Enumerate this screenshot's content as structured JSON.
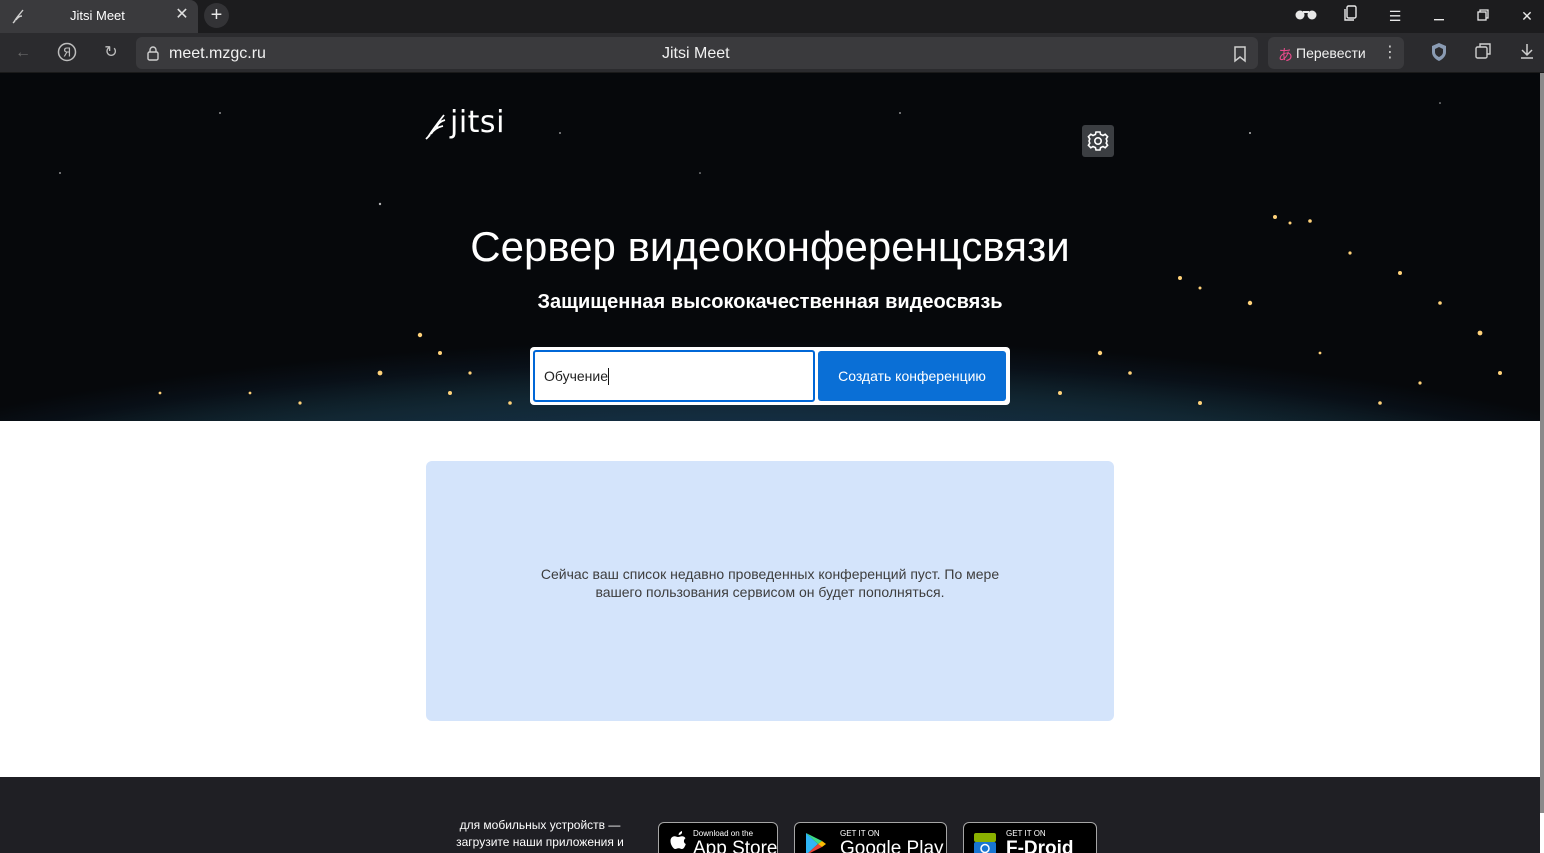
{
  "browser": {
    "tab_title": "Jitsi Meet",
    "url": "meet.mzgc.ru",
    "page_title": "Jitsi Meet",
    "translate_label": "Перевести"
  },
  "hero": {
    "logo_text": "jitsi",
    "title": "Сервер видеоконференцсвязи",
    "subtitle": "Защищенная высококачественная видеосвязь",
    "room_input_value": "Обучение",
    "create_button_label": "Создать конференцию"
  },
  "recent": {
    "empty_message": "Сейчас ваш список недавно проведенных конференций пуст. По мере вашего пользования сервисом он будет пополняться."
  },
  "footer": {
    "mobile_text": "для мобильных устройств — загрузите наши приложения и",
    "appstore_small": "Download on the",
    "appstore_big": "App Store",
    "googleplay_small": "GET IT ON",
    "googleplay_big": "Google Play",
    "fdroid_small": "GET IT ON",
    "fdroid_big": "F-Droid"
  },
  "colors": {
    "accent": "#0a6fd6",
    "recent_bg": "#d4e4fb",
    "footer_bg": "#1f1f24"
  }
}
